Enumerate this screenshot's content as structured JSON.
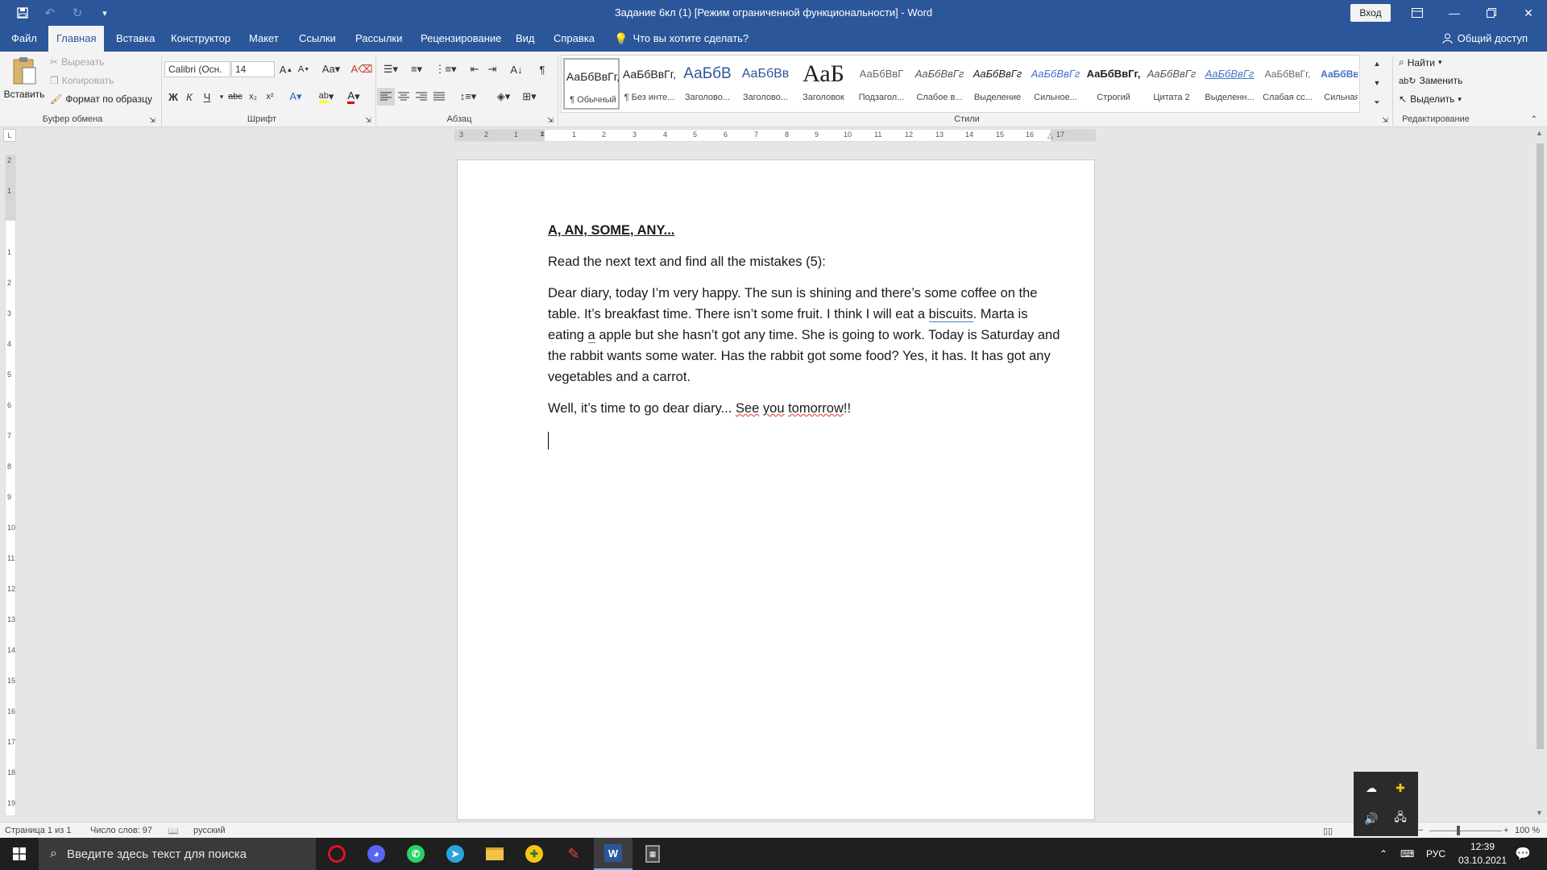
{
  "window": {
    "title": "Задание 6кл (1) [Режим ограниченной функциональности]  -  Word",
    "login_label": "Вход"
  },
  "tabs": [
    "Файл",
    "Главная",
    "Вставка",
    "Конструктор",
    "Макет",
    "Ссылки",
    "Рассылки",
    "Рецензирование",
    "Вид",
    "Справка"
  ],
  "tell_me": "Что вы хотите сделать?",
  "share_label": "Общий доступ",
  "ribbon": {
    "clipboard": {
      "paste": "Вставить",
      "cut": "Вырезать",
      "copy": "Копировать",
      "format_painter": "Формат по образцу",
      "group_label": "Буфер обмена"
    },
    "font": {
      "name": "Calibri (Осн.",
      "size": "14",
      "group_label": "Шрифт"
    },
    "paragraph": {
      "group_label": "Абзац"
    },
    "styles": {
      "group_label": "Стили",
      "items": [
        {
          "sample": "АаБбВвГг,",
          "name": "¶ Обычный"
        },
        {
          "sample": "АаБбВвГг,",
          "name": "¶ Без инте..."
        },
        {
          "sample": "АаБбВ",
          "name": "Заголово..."
        },
        {
          "sample": "АаБбВв",
          "name": "Заголово..."
        },
        {
          "sample": "АаБ",
          "name": "Заголовок"
        },
        {
          "sample": "АаБбВвГ",
          "name": "Подзагол..."
        },
        {
          "sample": "АаБбВвГг",
          "name": "Слабое в..."
        },
        {
          "sample": "АаБбВвГг",
          "name": "Выделение"
        },
        {
          "sample": "АаБбВвГг",
          "name": "Сильное..."
        },
        {
          "sample": "АаБбВвГг,",
          "name": "Строгий"
        },
        {
          "sample": "АаБбВвГг",
          "name": "Цитата 2"
        },
        {
          "sample": "АаБбВвГг",
          "name": "Выделенн..."
        },
        {
          "sample": "АаБбВвГг,",
          "name": "Слабая сс..."
        },
        {
          "sample": "АаБбВвГг,",
          "name": "Сильная..."
        }
      ]
    },
    "editing": {
      "find": "Найти",
      "replace": "Заменить",
      "select": "Выделить",
      "group_label": "Редактирование"
    }
  },
  "ruler": {
    "h_numbers": [
      "3",
      "2",
      "1",
      "1",
      "2",
      "3",
      "4",
      "5",
      "6",
      "7",
      "8",
      "9",
      "10",
      "11",
      "12",
      "13",
      "14",
      "15",
      "16",
      "17"
    ],
    "v_numbers": [
      "2",
      "1",
      "1",
      "2",
      "3",
      "4",
      "5",
      "6",
      "7",
      "8",
      "9",
      "10",
      "11",
      "12",
      "13",
      "14",
      "15",
      "16",
      "17",
      "18",
      "19"
    ]
  },
  "document": {
    "heading": " A, AN, SOME, ANY...",
    "instruction": " Read the next text and find all the mistakes (5):",
    "para1_a": "Dear diary, today I’m very happy. The sun is shining and there’s some coffee on the table. It’s breakfast time. There isn’t some fruit. I think I will eat a ",
    "para1_biscuits": "biscuits",
    "para1_b": ". Marta is eating ",
    "para1_a_word": "a",
    "para1_c": " apple but she hasn’t got any time. She is going to work. Today is Saturday and the rabbit wants some water. Has the rabbit got some food? Yes, it has. It has got any vegetables and a carrot.",
    "para2_a": "Well, it’s time to go dear diary... ",
    "para2_see": "See",
    "para2_you": "you",
    "para2_tomorrow": "tomorrow",
    "para2_end": "!!"
  },
  "status": {
    "page": "Страница 1 из 1",
    "words": "Число слов: 97",
    "language": "русский",
    "zoom": "100 %"
  },
  "taskbar": {
    "search_placeholder": "Введите здесь текст для поиска",
    "lang": "РУС",
    "time": "12:39",
    "date": "03.10.2021"
  },
  "colors": {
    "accent": "#2b579a",
    "opera": "#e0102b",
    "discord": "#5865f2",
    "whatsapp": "#25d366",
    "telegram": "#2aa3de",
    "word": "#2b579a"
  }
}
